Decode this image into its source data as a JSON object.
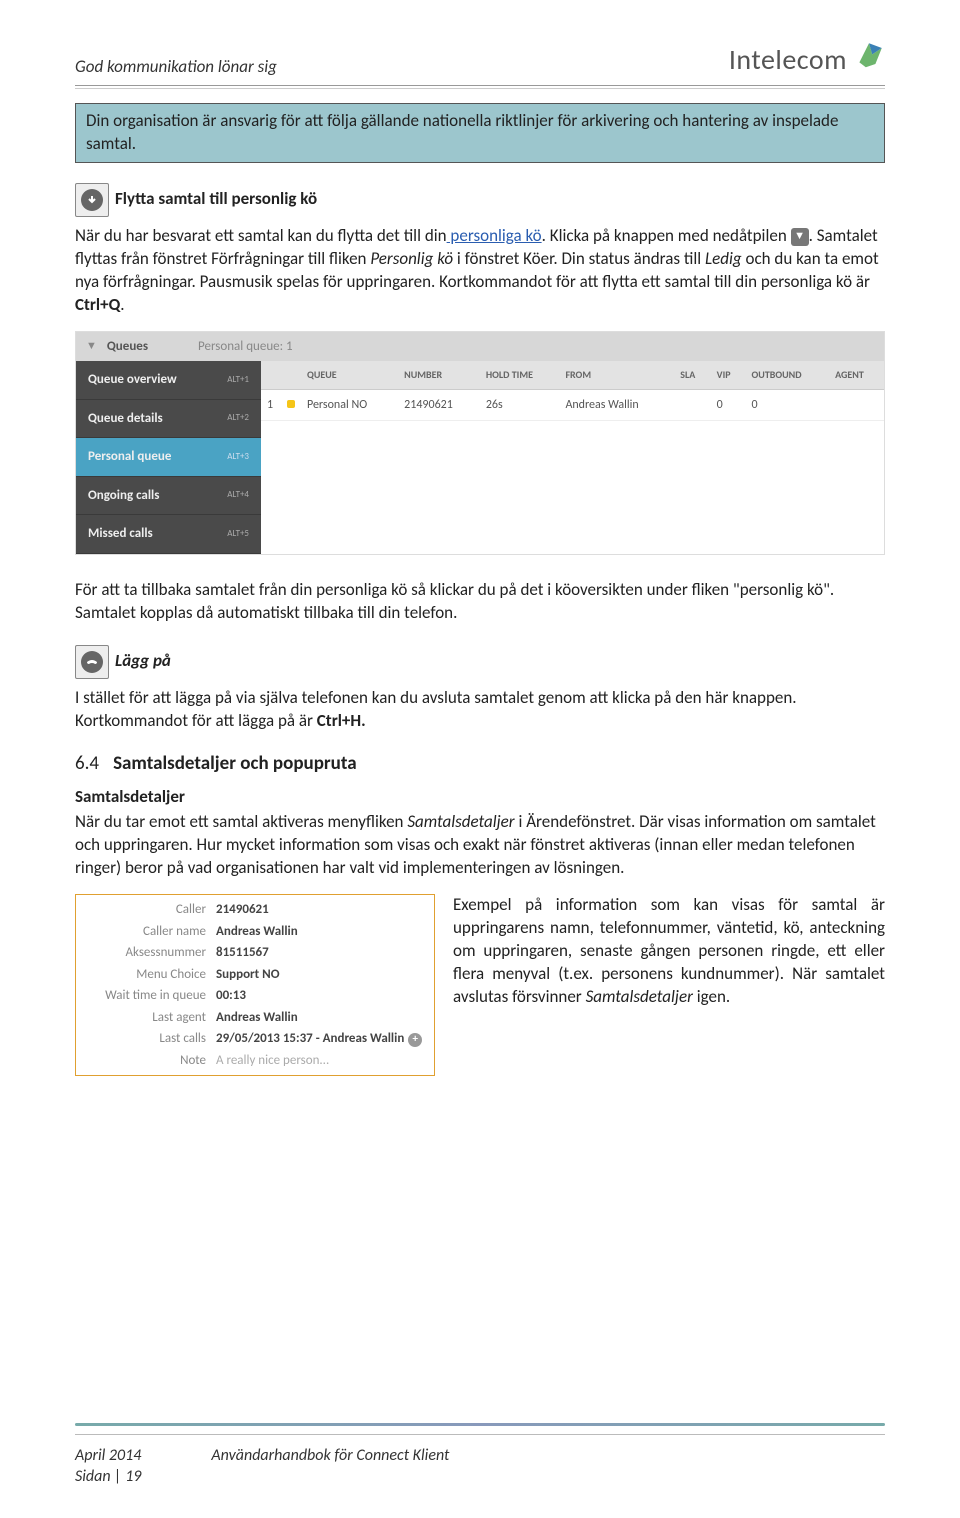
{
  "header": {
    "tagline": "God kommunikation lönar sig",
    "logo_text": "Intelecom"
  },
  "callout": {
    "text": "Din organisation är ansvarig för att följa gällande nationella riktlinjer för arkivering och hantering av inspelade samtal."
  },
  "sec1": {
    "title": "Flytta samtal till personlig kö",
    "p1_a": "När du har besvarat ett samtal kan du flytta det till din",
    "p1_link": " personliga kö",
    "p1_b": ". Klicka på knappen med nedåtpilen ",
    "p1_c": ". Samtalet flyttas från fönstret Förfrågningar till fliken ",
    "p1_i1": "Personlig kö",
    "p1_d": " i fönstret Köer. Din status ändras till ",
    "p1_i2": "Ledig",
    "p1_e": " och du kan ta emot nya förfrågningar. Pausmusik spelas för uppringaren. Kortkommandot för att flytta ett samtal till din personliga kö är ",
    "p1_bold": "Ctrl+Q",
    "p1_f": "."
  },
  "queues_panel": {
    "header_label": "Queues",
    "header_status": "Personal queue: 1",
    "sidebar": [
      {
        "label": "Queue overview",
        "shortcut": "ALT+1"
      },
      {
        "label": "Queue details",
        "shortcut": "ALT+2"
      },
      {
        "label": "Personal queue",
        "shortcut": "ALT+3"
      },
      {
        "label": "Ongoing calls",
        "shortcut": "ALT+4"
      },
      {
        "label": "Missed calls",
        "shortcut": "ALT+5"
      }
    ],
    "columns": [
      "",
      "",
      "QUEUE",
      "NUMBER",
      "HOLD TIME",
      "FROM",
      "SLA",
      "VIP",
      "OUTBOUND",
      "AGENT"
    ],
    "row": {
      "idx": "1",
      "queue": "Personal NO",
      "number": "21490621",
      "hold": "26s",
      "from": "Andreas Wallin",
      "sla": "",
      "vip": "0",
      "outbound": "0",
      "agent": ""
    }
  },
  "sec1b": {
    "p": "För att ta tillbaka samtalet från din personliga kö så klickar du på det i köoversikten under fliken \"personlig kö\". Samtalet kopplas då automatiskt tillbaka till din telefon."
  },
  "sec2": {
    "title": "Lägg på",
    "p_a": "I stället för att lägga på via själva telefonen kan du avsluta samtalet genom att klicka på den här knappen. Kortkommandot för att lägga på är ",
    "p_bold": "Ctrl+H.",
    "p_b": ""
  },
  "sec3": {
    "num": "6.4",
    "title": "Samtalsdetaljer och popupruta",
    "sub": "Samtalsdetaljer",
    "p_a": "När du tar emot ett samtal aktiveras menyfliken ",
    "p_i1": "Samtalsdetaljer",
    "p_b": " i Ärendefönstret. Där visas information om samtalet och uppringaren. Hur mycket information som visas och exakt när fönstret aktiveras (innan eller medan telefonen ringer) beror på vad organisationen har valt vid implementeringen av lösningen."
  },
  "details": {
    "rows": [
      {
        "k": "Caller",
        "v": "21490621"
      },
      {
        "k": "Caller name",
        "v": "Andreas Wallin"
      },
      {
        "k": "Aksessnummer",
        "v": "81511567"
      },
      {
        "k": "Menu Choice",
        "v": "Support NO"
      },
      {
        "k": "Wait time in queue",
        "v": "00:13"
      },
      {
        "k": "Last agent",
        "v": "Andreas Wallin"
      },
      {
        "k": "Last calls",
        "v": "29/05/2013 15:37 - Andreas Wallin"
      },
      {
        "k": "Note",
        "v": "A really nice person..."
      }
    ],
    "side_a": "Exempel på information som kan visas för samtal är uppringarens namn, telefonnummer, väntetid, kö, anteckning om uppringaren, senaste gången personen ringde, ett eller flera menyval (t.ex. personens kundnummer). När samtalet avslutas försvinner ",
    "side_i": "Samtalsdetaljer",
    "side_b": " igen."
  },
  "footer": {
    "left": "April 2014",
    "center": "Användarhandbok för Connect Klient",
    "page": "Sidan | 19"
  }
}
